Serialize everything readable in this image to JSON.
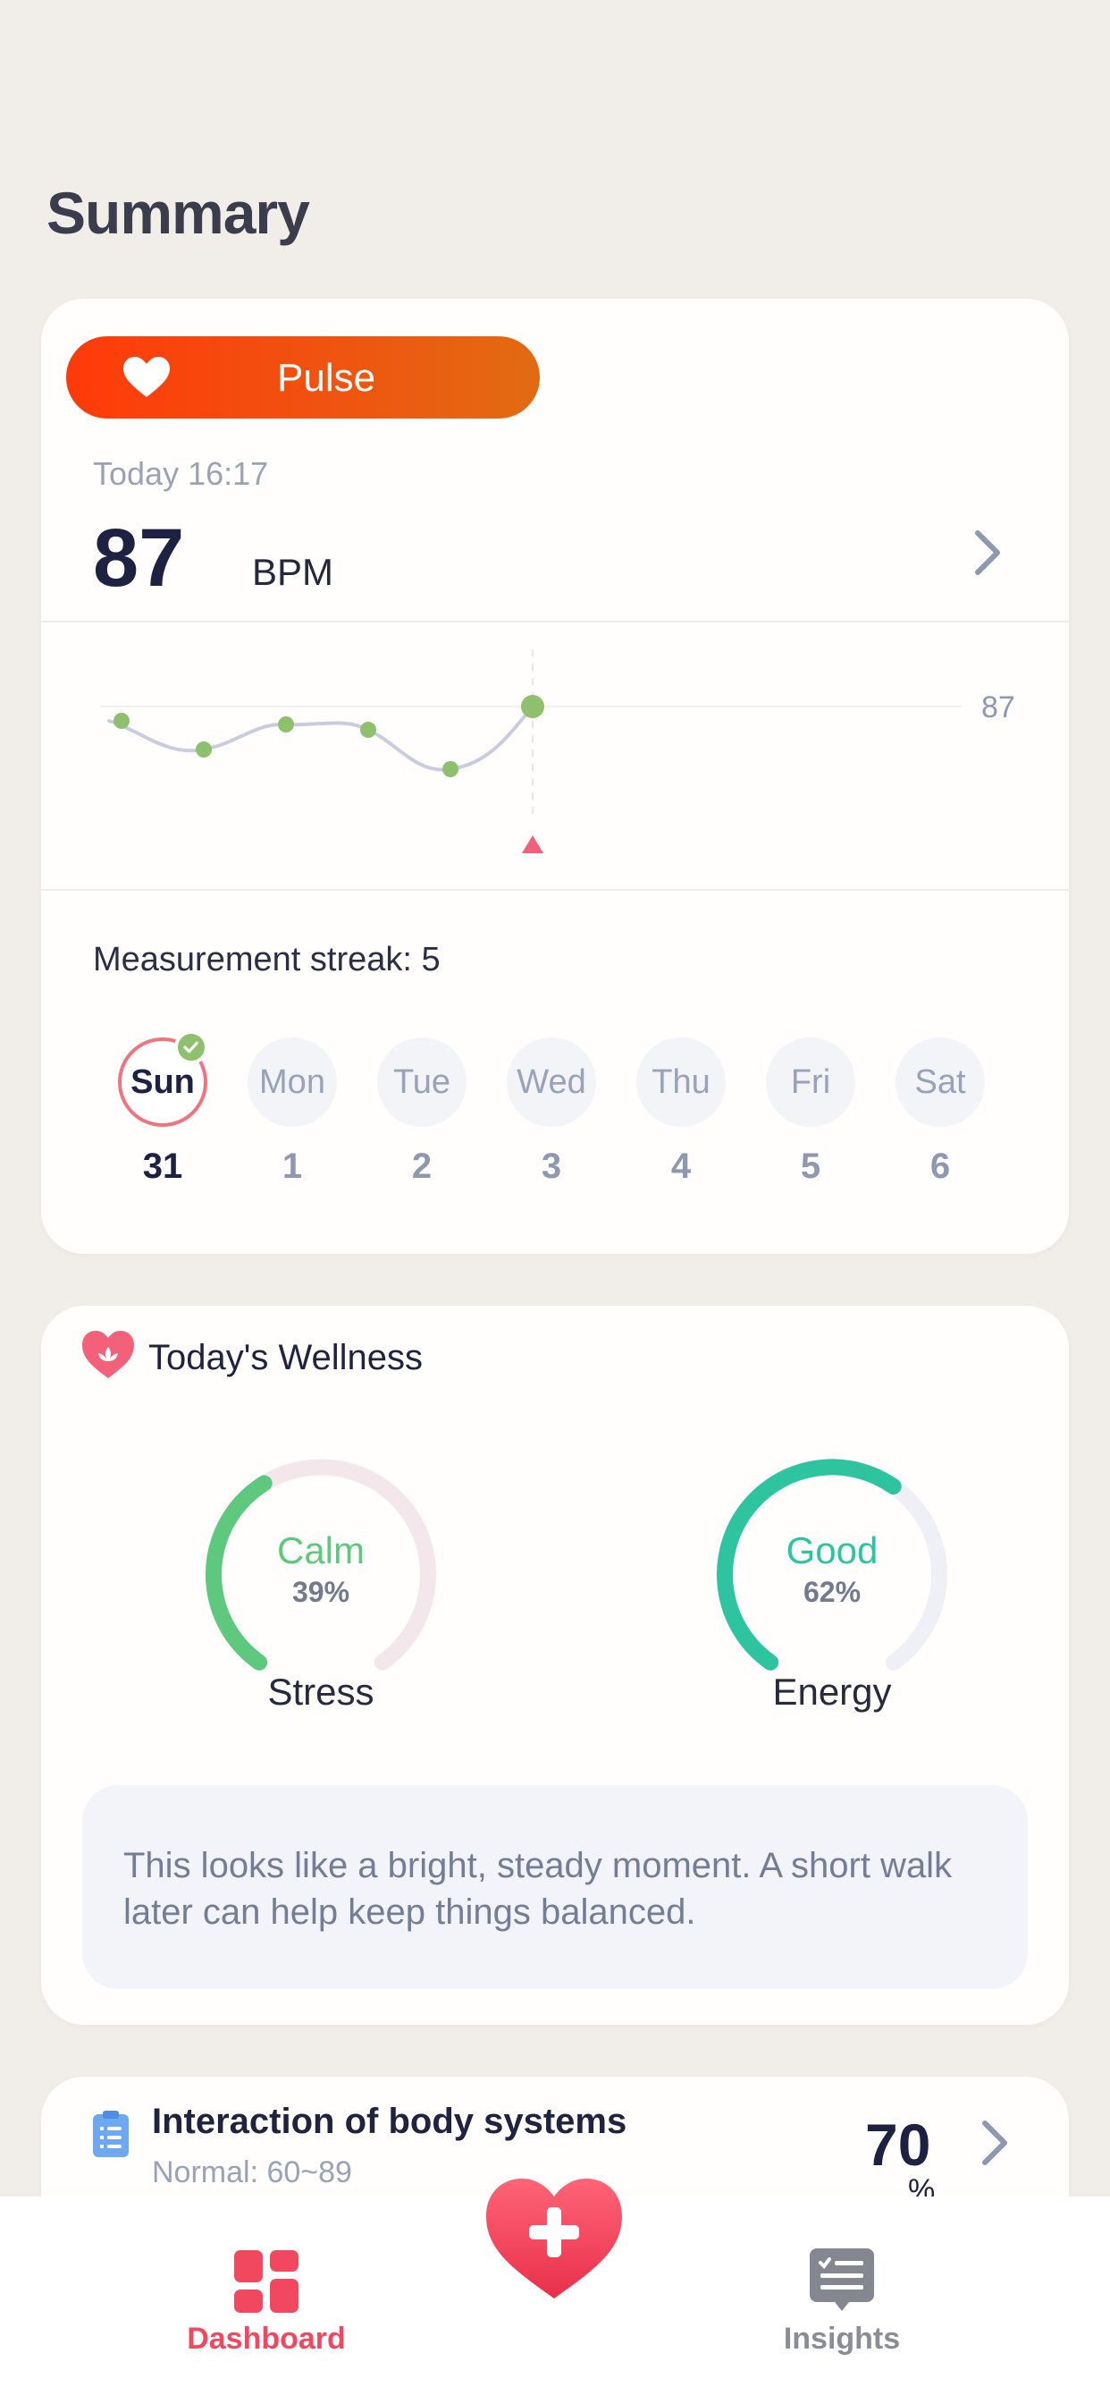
{
  "page": {
    "title": "Summary"
  },
  "pulse_card": {
    "pill_label": "Pulse",
    "timestamp": "Today 16:17",
    "value": "87",
    "unit": "BPM",
    "chart_ref_label": "87",
    "streak_label": "Measurement streak: 5",
    "days": [
      {
        "name": "Sun",
        "num": "31",
        "active": true,
        "checked": true
      },
      {
        "name": "Mon",
        "num": "1"
      },
      {
        "name": "Tue",
        "num": "2"
      },
      {
        "name": "Wed",
        "num": "3"
      },
      {
        "name": "Thu",
        "num": "4"
      },
      {
        "name": "Fri",
        "num": "5"
      },
      {
        "name": "Sat",
        "num": "6"
      }
    ],
    "colors": {
      "pill_start": "#ff3a0a",
      "pill_end": "#e26b12",
      "point": "#8ec06e",
      "marker": "#f2607a"
    }
  },
  "wellness_card": {
    "title": "Today's Wellness",
    "stress": {
      "state": "Calm",
      "percent": "39%",
      "fraction": 0.39,
      "name": "Stress",
      "color": "#5ec87f"
    },
    "energy": {
      "state": "Good",
      "percent": "62%",
      "fraction": 0.62,
      "name": "Energy",
      "color": "#2fc4a0"
    },
    "note": "This looks like a bright, steady moment. A short walk later can help keep things balanced."
  },
  "body_card": {
    "title": "Interaction of body systems",
    "subtitle": "Normal: 60~89",
    "value": "70",
    "unit": "%"
  },
  "tabbar": {
    "dashboard_label": "Dashboard",
    "insights_label": "Insights",
    "colors": {
      "active": "#f2485f",
      "inactive": "#8a8d96"
    }
  }
}
